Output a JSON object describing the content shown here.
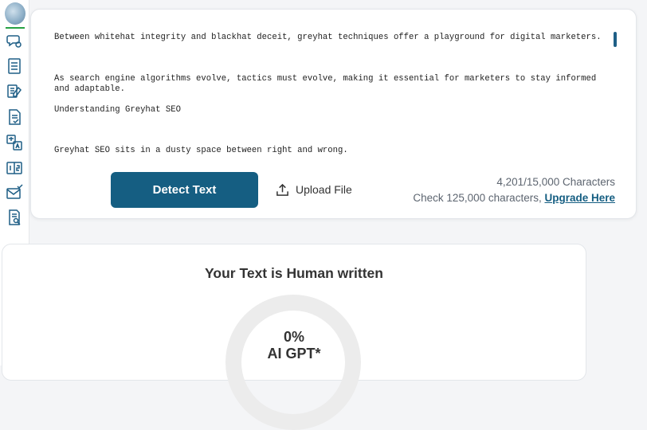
{
  "editor": {
    "paragraphs": [
      "Between whitehat integrity and blackhat deceit, greyhat techniques offer a playground for digital marketers.",
      "As search engine algorithms evolve, tactics must evolve, making it essential for marketers to stay informed and adaptable.",
      "Understanding Greyhat SEO",
      "Greyhat SEO sits in a dusty space between right and wrong."
    ]
  },
  "actions": {
    "detect_label": "Detect Text",
    "upload_label": "Upload File"
  },
  "counter": {
    "chars": "4,201/15,000 Characters",
    "check_text": "Check 125,000 characters,",
    "upgrade_label": "Upgrade Here"
  },
  "result": {
    "title": "Your Text is Human written",
    "percent": "0%",
    "label": "AI GPT*"
  },
  "colors": {
    "accent": "#155e82",
    "rail_icon": "#1f5f86",
    "logo_underline": "#27a243"
  },
  "sidebar": {
    "icons": [
      "brain-logo",
      "chat-gear-icon",
      "document-list-icon",
      "rewrite-icon",
      "document-check-icon",
      "translate-icon",
      "counter-icon",
      "email-check-icon",
      "document-search-icon"
    ]
  }
}
